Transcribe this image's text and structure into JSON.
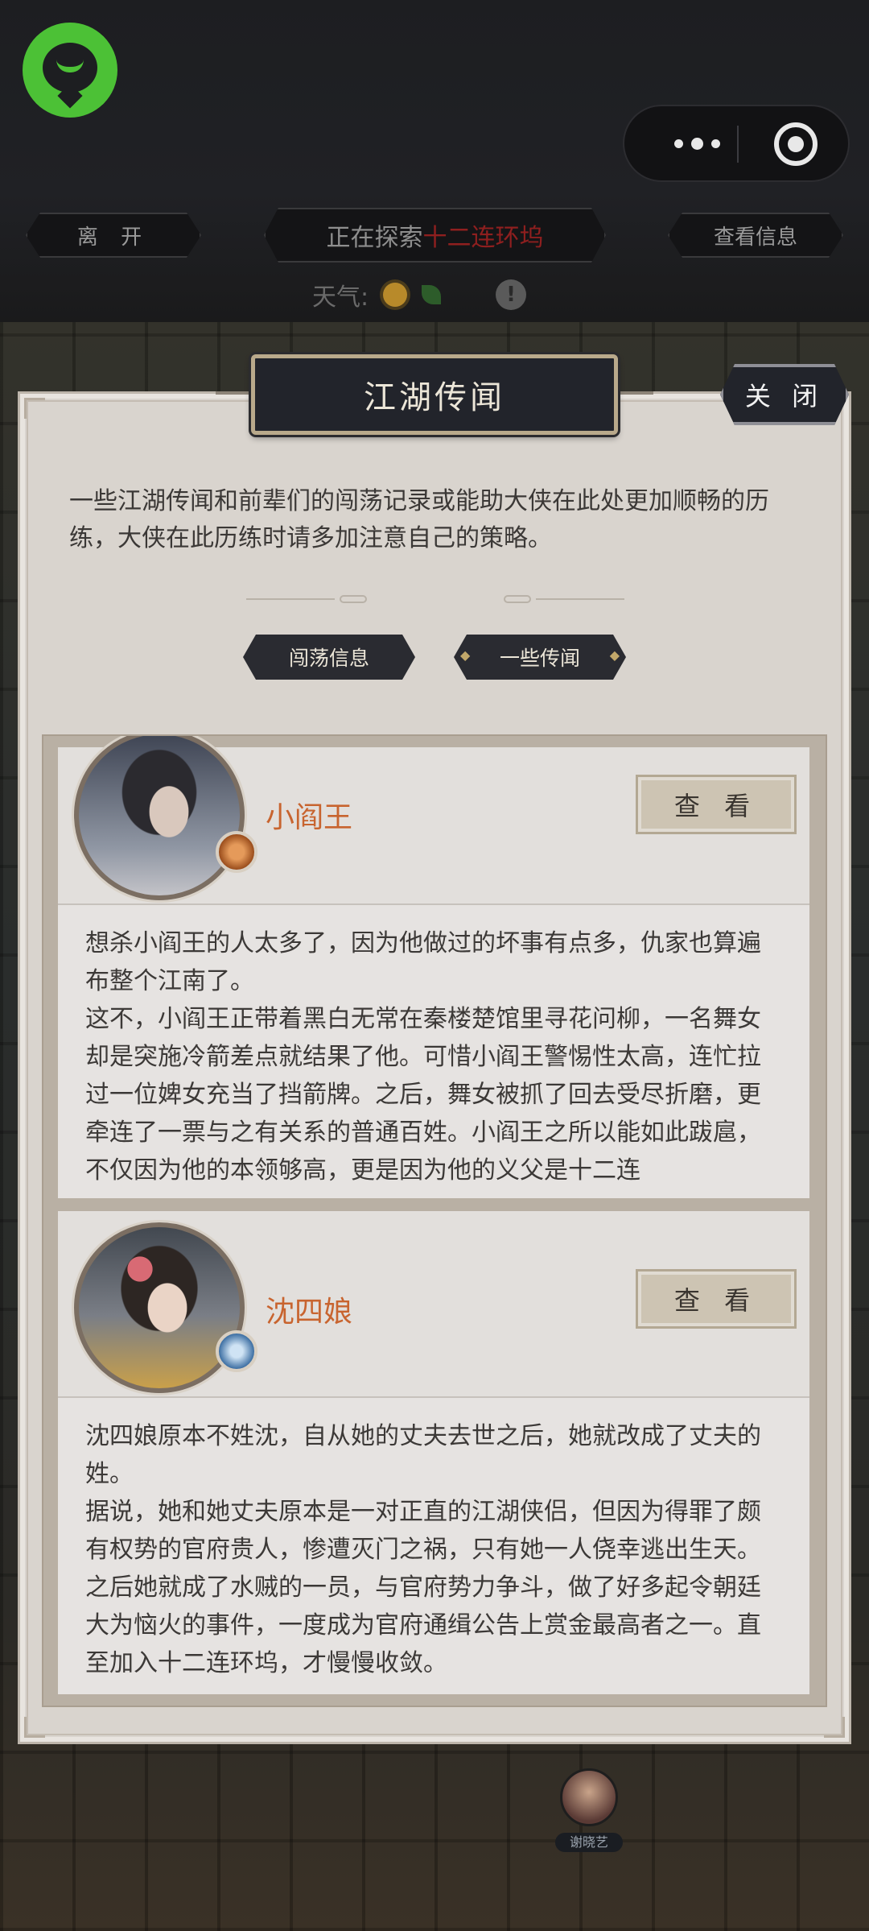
{
  "header": {
    "leave_label": "离 开",
    "exploring_prefix": "正在探索",
    "exploring_location": "十二连环坞",
    "view_info_label": "查看信息",
    "weather_label": "天气:",
    "weather_warn": "!"
  },
  "capsule": {
    "more_icon": "more-dots-icon",
    "exit_icon": "target-circle-icon"
  },
  "modal": {
    "title": "江湖传闻",
    "close_label": "关 闭",
    "intro": "一些江湖传闻和前辈们的闯荡记录或能助大侠在此处更加顺畅的历练，大侠在此历练时请多加注意自己的策略。",
    "tabs": [
      {
        "label": "闯荡信息",
        "active": false
      },
      {
        "label": "一些传闻",
        "active": true
      }
    ],
    "cards": [
      {
        "name": "小阎王",
        "view_label": "查 看",
        "paragraphs": [
          "想杀小阎王的人太多了，因为他做过的坏事有点多，仇家也算遍布整个江南了。",
          "这不，小阎王正带着黑白无常在秦楼楚馆里寻花问柳，一名舞女却是突施冷箭差点就结果了他。可惜小阎王警惕性太高，连忙拉过一位婢女充当了挡箭牌。之后，舞女被抓了回去受尽折磨，更牵连了一票与之有关系的普通百姓。小阎王之所以能如此跋扈，不仅因为他的本领够高，更是因为他的义父是十二连"
        ]
      },
      {
        "name": "沈四娘",
        "view_label": "查 看",
        "paragraphs": [
          "沈四娘原本不姓沈，自从她的丈夫去世之后，她就改成了丈夫的姓。",
          "据说，她和她丈夫原本是一对正直的江湖侠侣，但因为得罪了颇有权势的官府贵人，惨遭灭门之祸，只有她一人侥幸逃出生天。之后她就成了水贼的一员，与官府势力争斗，做了好多起令朝廷大为恼火的事件，一度成为官府通缉公告上赏金最高者之一。直至加入十二连环坞，才慢慢收敛。"
        ]
      }
    ]
  },
  "background": {
    "npc_tag": "谢晓艺"
  },
  "colors": {
    "accent_name": "#c8642f",
    "location_red": "#8f1f1f",
    "app_green": "#4cc136"
  }
}
